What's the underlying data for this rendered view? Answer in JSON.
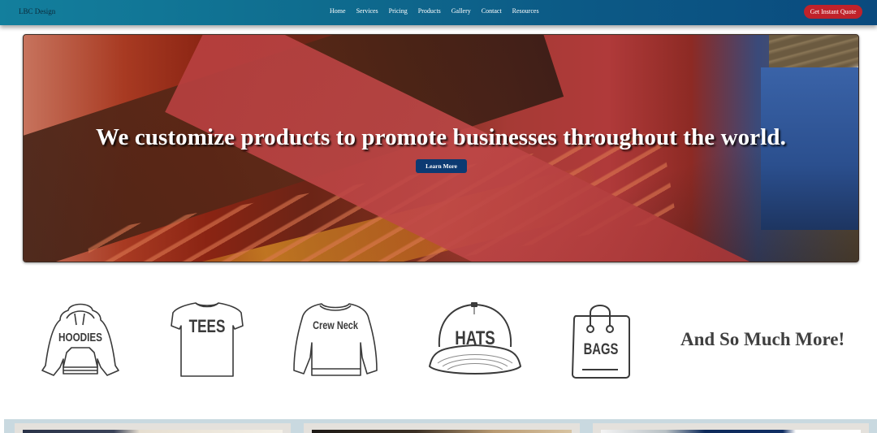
{
  "header": {
    "brand": "LBC Design",
    "nav": [
      {
        "label": "Home"
      },
      {
        "label": "Services"
      },
      {
        "label": "Pricing"
      },
      {
        "label": "Products"
      },
      {
        "label": "Gallery"
      },
      {
        "label": "Contact"
      },
      {
        "label": "Resources"
      }
    ],
    "cta_label": "Get Instant Quote"
  },
  "hero": {
    "headline": "We customize products to promote businesses throughout the world.",
    "button_label": "Learn More",
    "image_description": "close-up of a red heat press machine"
  },
  "products": {
    "items": [
      {
        "label": "HOODIES",
        "icon": "hoodie-icon"
      },
      {
        "label": "TEES",
        "icon": "tshirt-icon"
      },
      {
        "label": "Crew Neck",
        "icon": "sweater-icon"
      },
      {
        "label": "HATS",
        "icon": "cap-icon"
      },
      {
        "label": "BAGS",
        "icon": "shopping-bag-icon"
      }
    ],
    "more_text": "And So Much More!"
  },
  "colors": {
    "header_gradient_start": "#137f9d",
    "header_gradient_end": "#0a4a7e",
    "cta_red": "#c0222a",
    "learn_more_blue": "#0c3a72",
    "icon_gray": "#3a3a3a",
    "cards_strip": "#c9d9e0"
  }
}
